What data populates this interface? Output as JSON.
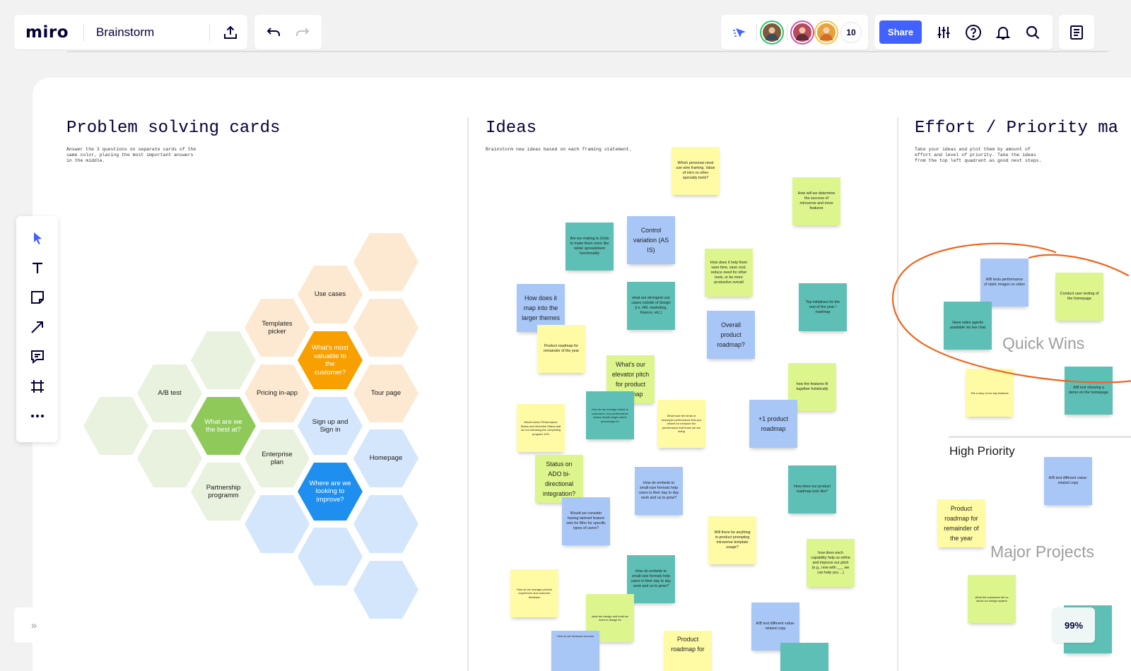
{
  "app": {
    "logo": "miro",
    "board_title": "Brainstorm"
  },
  "collab": {
    "extra_count": "10",
    "avatar_colors": [
      "#7c5a3c",
      "#b9495c",
      "#e6a23c"
    ]
  },
  "header": {
    "share_label": "Share"
  },
  "frames": {
    "problem": {
      "title": "Problem solving cards",
      "desc": "Answer the 3 questions on separate cards of the same color, placing the most important answers in the middle."
    },
    "ideas": {
      "title": "Ideas",
      "desc": "Brainstorm new ideas based on each framing statement."
    },
    "effort": {
      "title": "Effort / Priority ma",
      "desc": "Take your ideas and plot them by amount of effort and level of priority. Take the ideas from the top left quadrant as good next steps."
    }
  },
  "hexes": {
    "use_cases": "Use cases",
    "templates_picker": "Templates picker",
    "most_valuable": "What's most valuable to the customer?",
    "ab_test": "A/B test",
    "pricing": "Pricing in-app",
    "tour": "Tour page",
    "best_at": "What are we the best at?",
    "signup": "Sign up and Sign in",
    "enterprise": "Enterprise plan",
    "homepage": "Homepage",
    "partnership": "Partnership programm",
    "improve": "Where are we looking to improve?"
  },
  "stickies": {
    "s1": "Which personas most use wire framing. Value of miro vs other specialty tools?",
    "s2": "How will we determine the success of miroverse and more features",
    "s3": "Are we making to Grids to make them more like table/ spreadsheet functionality",
    "s4": "Control variation (AS IS)",
    "s5": "How does it help them save time, save cost, reduce need for other tools, or be more productive overall",
    "s6": "How does it map into the larger themes",
    "s7": "what are strongest use cases outside of design (i.e. HR, marketing, finance, etc.)",
    "s8": "Top initiatives for the rest of the year / roadmap",
    "s9": "Overall product roadmap?",
    "s10": "Product roadmap for remainder of the year",
    "s11": "What's our elevator pitch for product roadmap",
    "s12": "how the features fit together holistically",
    "s13": "What's Acme Performance Status and Silverline Status that we not releasing the compelling program 10%",
    "s14": "How do we manage rollout to customers, how performance teams decide target rollout percentage for",
    "s15": "What have the kinds of employee performance that you deliver for measure the performance that those we are doing",
    "s16": "+1 product roadmap",
    "s17": "Status on ADO bi-directional integration?",
    "s18": "How do embeds to small-size formats help users in their day to day work and us to grow?",
    "s19": "How does our product roadmap look like?",
    "s20": "Would we consider having tailored feature sets for Miro for specific types of users?",
    "s21": "Will there be anything in-product prompting miroverse template usage?",
    "s22": "how does each capability help us refine and improve our pitch (e.g., now with ___ we can help you ...)",
    "s23": "How do embeds to small-size formats help users in their day to day work and us to grow?",
    "s24": "How do we manage product experience and customer feedback",
    "s25": "what are design and tools we need to design for",
    "s26": "A/B test different value-related copy",
    "s27": "Product roadmap for",
    "s28": "How do we measure success",
    "e1": "A/B tests performance of static images vs video",
    "e2": "Conduct user testing of the homepage",
    "e3": "Have sales agents available via live chat",
    "e4": "Tell a story of our key features",
    "e5": "A/B test showing a demo on the homepage",
    "e6": "A/B test different value-related copy",
    "e7": "Product roadmap for remainder of the year",
    "e8": "What did customers tell us about our design system"
  },
  "quadrants": {
    "quick_wins": "Quick Wins",
    "high_priority": "High Priority",
    "major_projects": "Major Projects"
  },
  "status": {
    "zoom": "99%"
  },
  "colors": {
    "accent": "#4262ff",
    "orange_hex": "#f7a000",
    "green_hex": "#8fc95a",
    "blue_hex": "#1e8fef",
    "annotation": "#f2631c"
  }
}
